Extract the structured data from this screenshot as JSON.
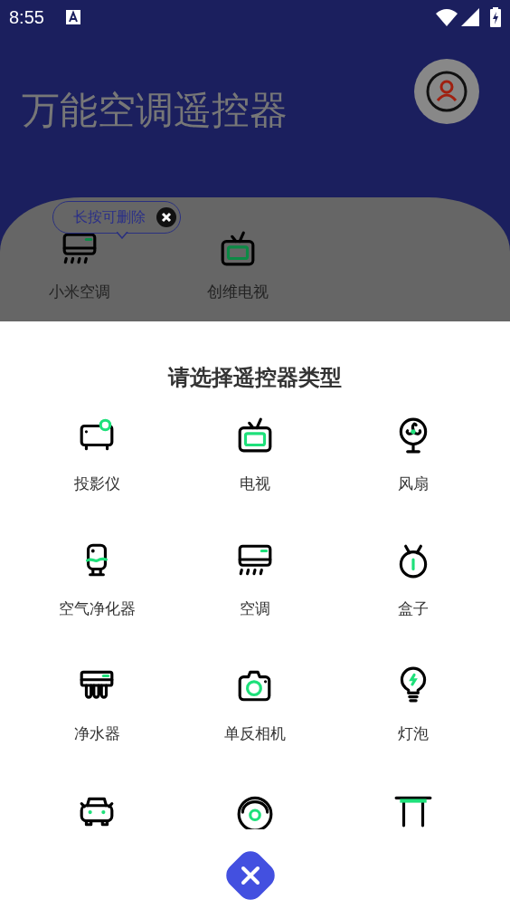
{
  "status_bar": {
    "time": "8:55"
  },
  "header": {
    "title": "万能空调遥控器"
  },
  "saved_devices": {
    "tooltip": "长按可删除",
    "items": [
      {
        "kind": "ac",
        "label": "小米空调"
      },
      {
        "kind": "tv",
        "label": "创维电视"
      }
    ]
  },
  "sheet": {
    "title": "请选择遥控器类型",
    "types": [
      {
        "kind": "projector",
        "label": "投影仪"
      },
      {
        "kind": "tv",
        "label": "电视"
      },
      {
        "kind": "fan",
        "label": "风扇"
      },
      {
        "kind": "purifier",
        "label": "空气净化器"
      },
      {
        "kind": "ac",
        "label": "空调"
      },
      {
        "kind": "box",
        "label": "盒子"
      },
      {
        "kind": "water",
        "label": "净水器"
      },
      {
        "kind": "camera",
        "label": "单反相机"
      },
      {
        "kind": "bulb",
        "label": "灯泡"
      },
      {
        "kind": "car"
      },
      {
        "kind": "vacuum"
      },
      {
        "kind": "table"
      }
    ]
  }
}
